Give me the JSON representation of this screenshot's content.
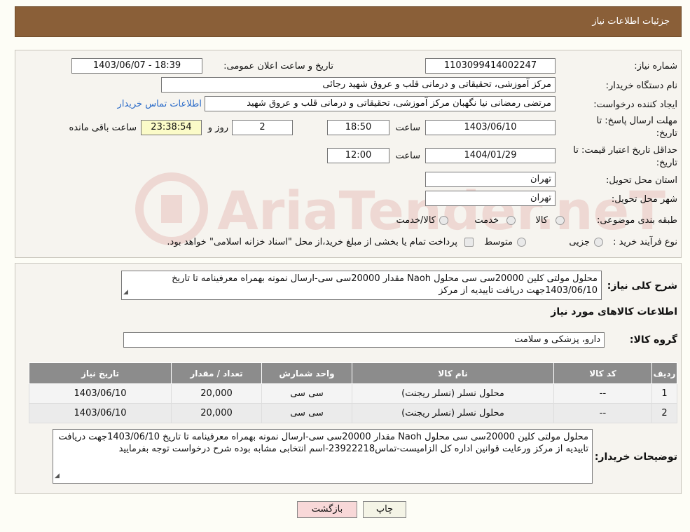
{
  "header": {
    "title": "جزئیات اطلاعات نیاز"
  },
  "form": {
    "need_number_label": "شماره نیاز:",
    "need_number": "1103099414002247",
    "announce_label": "تاریخ و ساعت اعلان عمومی:",
    "announce_value": "1403/06/07 - 18:39",
    "buyer_org_label": "نام دستگاه خریدار:",
    "buyer_org": "مرکز آموزشی، تحقیقاتی و درمانی قلب و عروق شهید رجائی",
    "requester_label": "ایجاد کننده درخواست:",
    "requester": "مرتضی رمضانی نیا نگهبان مرکز آموزشی، تحقیقاتی و درمانی قلب و عروق شهید",
    "contact_link": "اطلاعات تماس خریدار",
    "deadline_label_1": "مهلت ارسال پاسخ: تا",
    "deadline_label_2": "تاریخ:",
    "deadline_date": "1403/06/10",
    "time_label": "ساعت",
    "deadline_time": "18:50",
    "days_value": "2",
    "days_label": "روز و",
    "remaining_time": "23:38:54",
    "remaining_label": "ساعت باقی مانده",
    "validity_label_1": "حداقل تاریخ اعتبار قیمت: تا",
    "validity_label_2": "تاریخ:",
    "validity_date": "1404/01/29",
    "validity_time": "12:00",
    "province_label": "استان محل تحویل:",
    "province": "تهران",
    "city_label": "شهر محل تحویل:",
    "city": "تهران",
    "category_label": "طبقه بندی موضوعی:",
    "category_options": [
      "کالا",
      "خدمت",
      "کالا/خدمت"
    ],
    "process_label": "نوع فرآیند خرید :",
    "process_options": [
      "جزیی",
      "متوسط"
    ],
    "process_note": "پرداخت تمام یا بخشی از مبلغ خرید،از محل \"اسناد خزانه اسلامی\" خواهد بود."
  },
  "watermark": {
    "text": "AriaTender.neT"
  },
  "details": {
    "summary_label": "شرح کلی نیاز:",
    "summary_text": "محلول مولتی کلین 20000سی سی محلول Naoh مقدار 20000سی سی-ارسال نمونه بهمراه معرفینامه تا تاریخ 1403/06/10جهت دریافت تاییدیه از مرکز",
    "items_title": "اطلاعات کالاهای مورد نیاز",
    "group_label": "گروه کالا:",
    "group_value": "دارو، پزشکی و سلامت"
  },
  "table": {
    "headers": [
      "ردیف",
      "کد کالا",
      "نام کالا",
      "واحد شمارش",
      "تعداد / مقدار",
      "تاریخ نیاز"
    ],
    "rows": [
      [
        "1",
        "--",
        "محلول نسلر (نسلر ریجنت)",
        "سی سی",
        "20,000",
        "1403/06/10"
      ],
      [
        "2",
        "--",
        "محلول نسلر (نسلر ریجنت)",
        "سی سی",
        "20,000",
        "1403/06/10"
      ]
    ]
  },
  "buyer_notes": {
    "label": "توضیحات خریدار:",
    "text": "محلول مولتی کلین 20000سی سی محلول Naoh مقدار 20000سی سی-ارسال نمونه بهمراه معرفینامه تا تاریخ 1403/06/10جهت دریافت تاییدیه از مرکز ورعایت قوانین اداره کل الزامیست-تماس23922218-اسم انتخابی مشابه بوده شرح درخواست توجه بفرمایید"
  },
  "buttons": {
    "print": "چاپ",
    "back": "بازگشت"
  },
  "colors": {
    "header": "#8a5f38",
    "panel": "#f6f4ef",
    "table_header": "#8c8c8c",
    "link": "#2b6bc9",
    "back_button": "#f8d8d8"
  }
}
